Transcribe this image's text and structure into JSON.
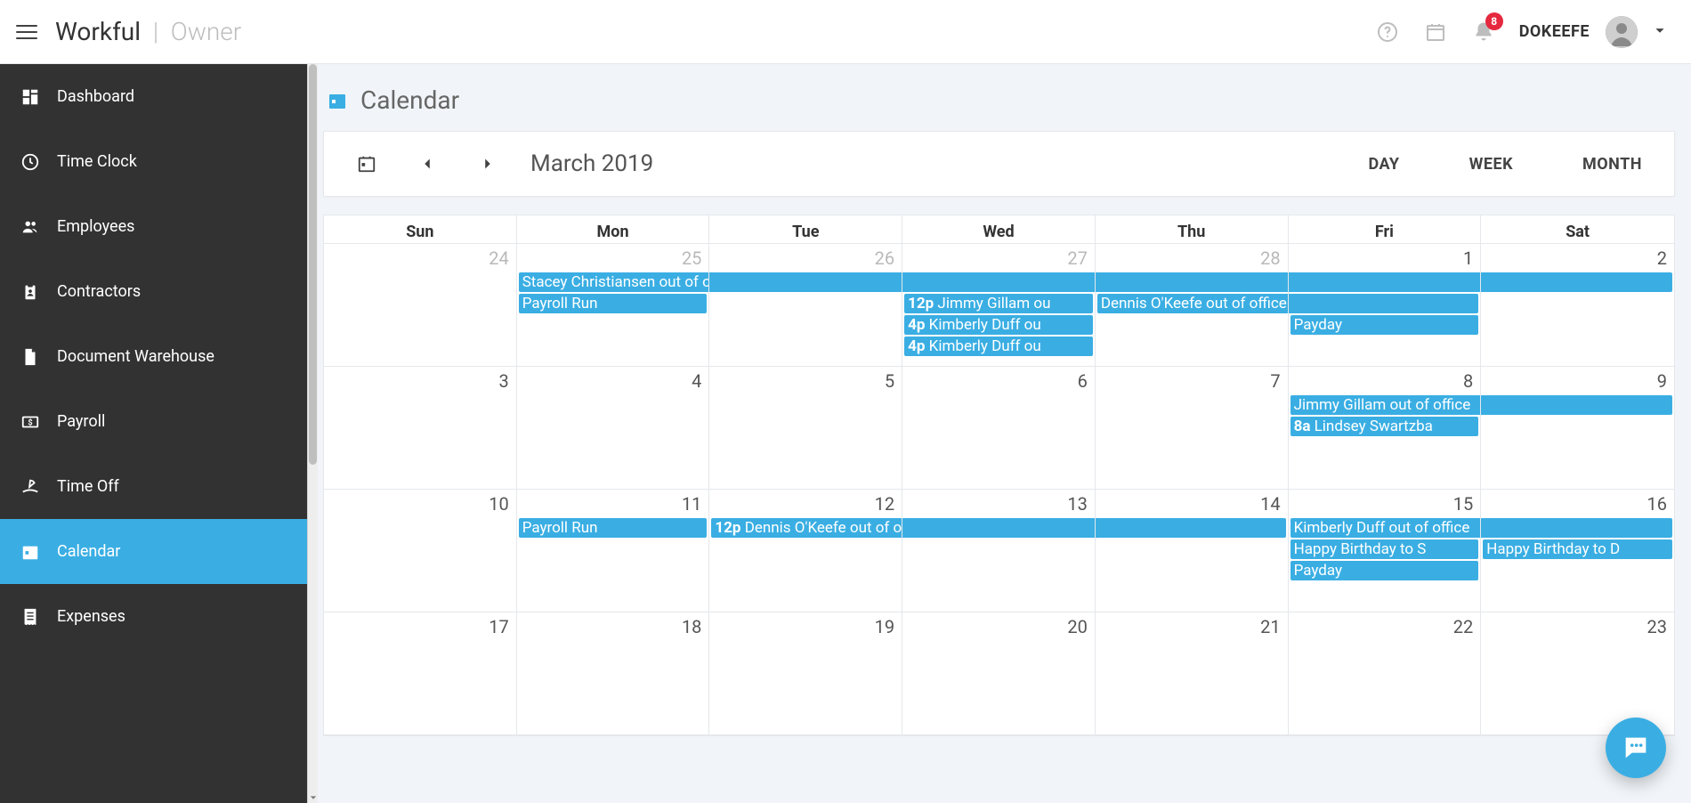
{
  "brand": {
    "name": "Workful",
    "role": "Owner"
  },
  "header": {
    "notification_count": "8",
    "username": "DOKEEFE"
  },
  "sidebar": {
    "items": [
      {
        "id": "dashboard",
        "label": "Dashboard",
        "icon": "dashboard-icon"
      },
      {
        "id": "timeclock",
        "label": "Time Clock",
        "icon": "clock-icon"
      },
      {
        "id": "employees",
        "label": "Employees",
        "icon": "people-icon"
      },
      {
        "id": "contractors",
        "label": "Contractors",
        "icon": "clipboard-icon"
      },
      {
        "id": "docware",
        "label": "Document Warehouse",
        "icon": "document-icon"
      },
      {
        "id": "payroll",
        "label": "Payroll",
        "icon": "money-icon"
      },
      {
        "id": "timeoff",
        "label": "Time Off",
        "icon": "timeoff-icon"
      },
      {
        "id": "calendar",
        "label": "Calendar",
        "icon": "calendar-icon"
      },
      {
        "id": "expenses",
        "label": "Expenses",
        "icon": "receipt-icon"
      }
    ],
    "active": "calendar"
  },
  "page": {
    "title": "Calendar"
  },
  "toolbar": {
    "period": "March 2019",
    "views": {
      "day": "DAY",
      "week": "WEEK",
      "month": "MONTH"
    },
    "active_view": "month"
  },
  "calendar": {
    "day_headers": [
      "Sun",
      "Mon",
      "Tue",
      "Wed",
      "Thu",
      "Fri",
      "Sat"
    ],
    "weeks": [
      {
        "days": [
          {
            "num": "24",
            "other": true
          },
          {
            "num": "25",
            "other": true
          },
          {
            "num": "26",
            "other": true
          },
          {
            "num": "27",
            "other": true
          },
          {
            "num": "28",
            "other": true
          },
          {
            "num": "1"
          },
          {
            "num": "2"
          }
        ],
        "rows": [
          [
            null,
            {
              "text": "Stacey Christiansen out of office",
              "shape": "span"
            },
            {
              "text": "",
              "shape": "mid"
            },
            {
              "text": "",
              "shape": "mid"
            },
            {
              "text": "",
              "shape": "mid"
            },
            {
              "text": "",
              "shape": "mid"
            },
            {
              "text": "",
              "shape": "cont"
            }
          ],
          [
            null,
            {
              "text": "Payroll Run"
            },
            null,
            {
              "time": "12p",
              "text": "Jimmy Gillam ou"
            },
            {
              "text": "Dennis O'Keefe out of office",
              "shape": "span"
            },
            {
              "text": "",
              "shape": "cont"
            },
            null
          ],
          [
            null,
            null,
            null,
            {
              "time": "4p",
              "text": "Kimberly Duff ou"
            },
            null,
            {
              "text": "Payday"
            },
            null
          ],
          [
            null,
            null,
            null,
            {
              "time": "4p",
              "text": "Kimberly Duff ou"
            },
            null,
            null,
            null
          ]
        ]
      },
      {
        "days": [
          {
            "num": "3"
          },
          {
            "num": "4"
          },
          {
            "num": "5"
          },
          {
            "num": "6"
          },
          {
            "num": "7"
          },
          {
            "num": "8"
          },
          {
            "num": "9"
          }
        ],
        "rows": [
          [
            null,
            null,
            null,
            null,
            null,
            {
              "text": "Jimmy Gillam out of office",
              "shape": "span"
            },
            {
              "text": "",
              "shape": "cont"
            }
          ],
          [
            null,
            null,
            null,
            null,
            null,
            {
              "time": "8a",
              "text": "Lindsey Swartzba"
            },
            null
          ]
        ]
      },
      {
        "days": [
          {
            "num": "10"
          },
          {
            "num": "11"
          },
          {
            "num": "12"
          },
          {
            "num": "13"
          },
          {
            "num": "14"
          },
          {
            "num": "15"
          },
          {
            "num": "16"
          }
        ],
        "rows": [
          [
            null,
            {
              "text": "Payroll Run"
            },
            {
              "time": "12p",
              "text": "Dennis O'Keefe out of office",
              "shape": "span"
            },
            {
              "text": "",
              "shape": "mid"
            },
            {
              "text": "",
              "shape": "cont"
            },
            {
              "text": "Kimberly Duff out of office",
              "shape": "span"
            },
            {
              "text": "",
              "shape": "cont"
            }
          ],
          [
            null,
            null,
            null,
            null,
            null,
            {
              "text": "Happy Birthday to S"
            },
            {
              "text": "Happy Birthday to D"
            }
          ],
          [
            null,
            null,
            null,
            null,
            null,
            {
              "text": "Payday"
            },
            null
          ]
        ]
      },
      {
        "days": [
          {
            "num": "17"
          },
          {
            "num": "18"
          },
          {
            "num": "19"
          },
          {
            "num": "20"
          },
          {
            "num": "21"
          },
          {
            "num": "22"
          },
          {
            "num": "23"
          }
        ],
        "rows": []
      }
    ]
  }
}
